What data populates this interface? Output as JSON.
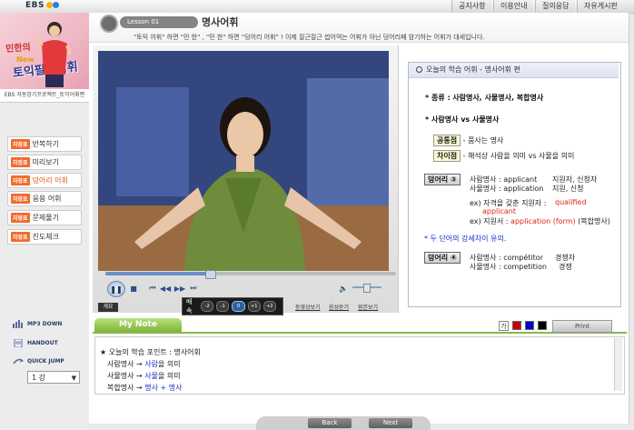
{
  "brand": {
    "logo": "EBS"
  },
  "top_nav": [
    "공지사항",
    "이용안내",
    "질의응답",
    "자유게시판"
  ],
  "banner": {
    "line1": "민한의",
    "line2": "토익필수어휘",
    "line3": "New",
    "caption": "EBS 자동암기프로젝트_토익어휘편"
  },
  "menu": {
    "tag": "자장표",
    "items": [
      "반복하기",
      "미리보기",
      "덩어리 어휘",
      "응용 어휘",
      "문제풀기",
      "진도체크"
    ],
    "active_index": 2
  },
  "tools": {
    "mp3": "MP3 DOWN",
    "handout": "HANDOUT",
    "quickjump": "QUICK JUMP",
    "lesson_select": "1 강"
  },
  "header": {
    "lesson": "Lesson 01",
    "title": "명사어휘",
    "subtitle": "\"토익 어휘\" 하면 \"민 한\" , \"민 한\" 하면 \"덩어리 어휘\" ! 이제 잘근잘근 썹어먹는 어휘가 아닌 덩어리째 암기하는 어휘가 대세입니다."
  },
  "player": {
    "progress_fraction": 0.36,
    "info_label": "개요",
    "speed_label": "배속",
    "speeds": [
      "-2",
      "-1",
      "0",
      "+1",
      "+2"
    ],
    "selected_speed_index": 2,
    "links": [
      "동영상보기",
      "음성듣기",
      "원본보기"
    ]
  },
  "content": {
    "header": "오늘의 학습 어휘 - 명사어휘 편",
    "kind_label": "* 종류 :",
    "kinds": "사람명사, 사물명사, 복합명사",
    "compare": "* 사람명사 vs 사물명사",
    "common_label": "공통점",
    "common_text": "- 품사는 명사",
    "diff_label": "차이점",
    "diff_text": "- 해석상 사람을 의미 vs 사물을 의미",
    "chunk3_label": "덩어리 ③",
    "chunk3_rows": [
      [
        "사람명사 : applicant",
        "지원자, 신청자"
      ],
      [
        "사물명사 : application",
        "지원, 신청"
      ]
    ],
    "ex1_prefix": "ex) 자격을 갖춘 지원자 :",
    "ex1_red": "qualified applicant",
    "ex2_prefix": "ex) 지원서 :",
    "ex2_red": "application (form)",
    "ex2_suffix": "(복합명사)",
    "tip": "* 두 단어의 강세차이 유의.",
    "chunk4_label": "덩어리 ④",
    "chunk4_rows": [
      [
        "사람명사 : compétitor",
        "경쟁자"
      ],
      [
        "사물명사 : competition",
        "경쟁"
      ]
    ]
  },
  "note": {
    "tab": "My Note",
    "font_button": "가",
    "print": "Print",
    "colors": [
      "#cc0000",
      "#0000cc",
      "#000000"
    ],
    "lines": [
      {
        "prefix": "★ 오늘의 학습 포인트 : 명사어휘",
        "blue": "",
        "suffix": ""
      },
      {
        "prefix": "사람명사 → ",
        "blue": "사람",
        "suffix": "을 의미"
      },
      {
        "prefix": "사물명사 → ",
        "blue": "사물",
        "suffix": "을 의미"
      },
      {
        "prefix": "복합명사 → ",
        "blue": "명사 + 명사",
        "suffix": ""
      }
    ]
  },
  "nav": {
    "back": "Back",
    "next": "Next"
  }
}
